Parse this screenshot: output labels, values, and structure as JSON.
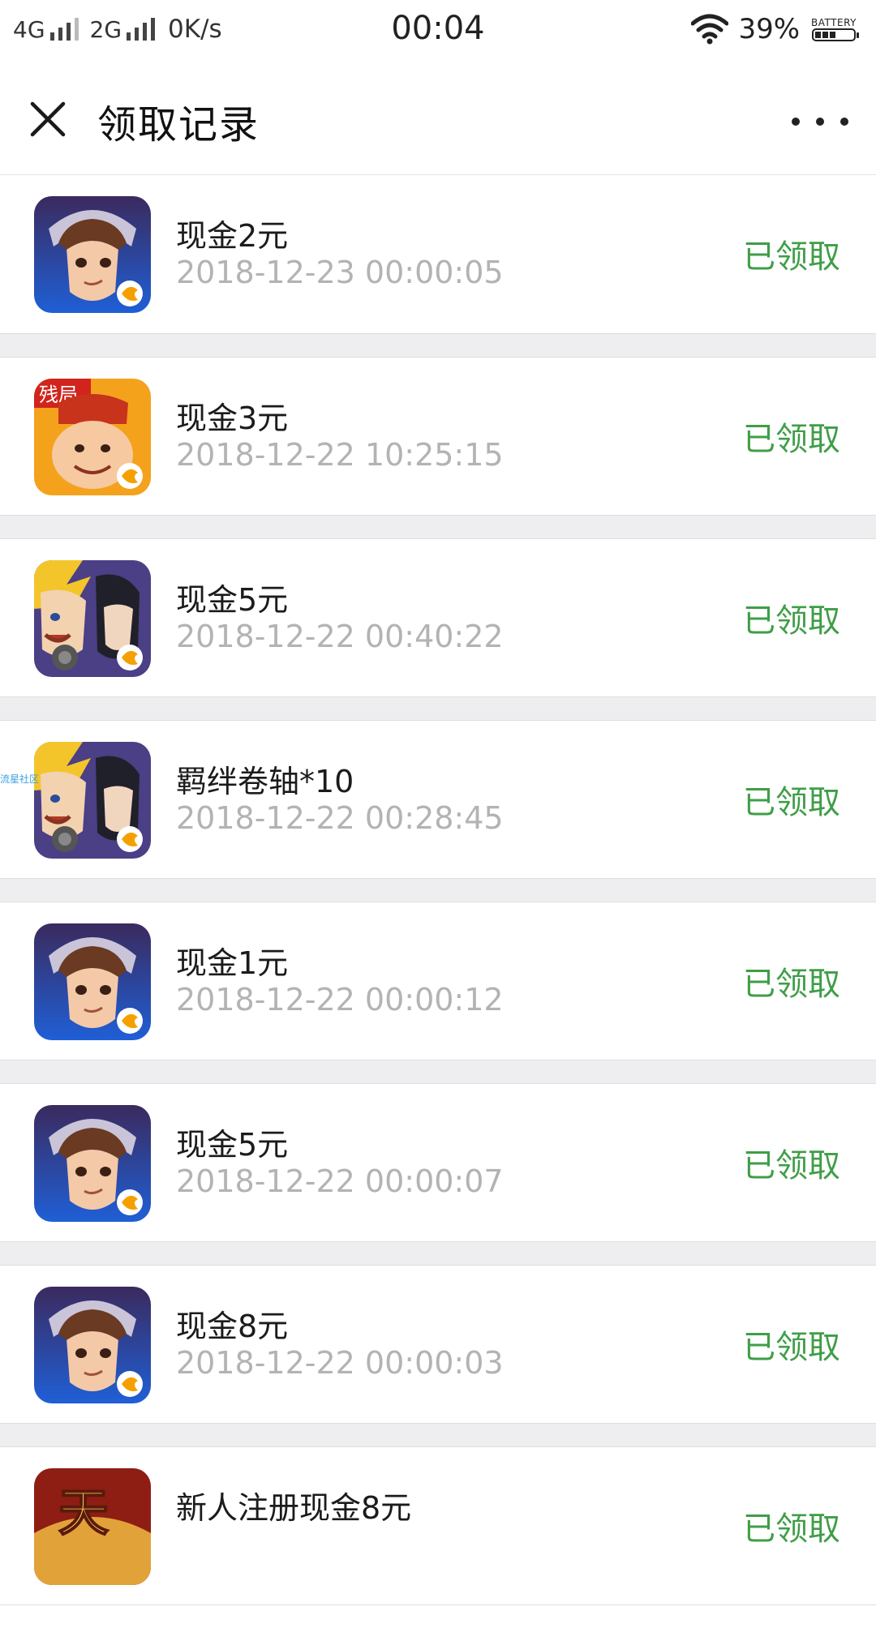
{
  "status_bar": {
    "net1": "4G",
    "net2": "2G",
    "speed": "0K/s",
    "time": "00:04",
    "battery_pct": "39%",
    "battery_label": "BATTERY"
  },
  "header": {
    "title": "领取记录"
  },
  "watermark": "流星社区",
  "records": [
    {
      "title": "现金2元",
      "time": "2018-12-23 00:00:05",
      "status": "已领取",
      "icon": "hero-game-icon"
    },
    {
      "title": "现金3元",
      "time": "2018-12-22 10:25:15",
      "status": "已领取",
      "icon": "card-game-icon",
      "badge": "残局"
    },
    {
      "title": "现金5元",
      "time": "2018-12-22 00:40:22",
      "status": "已领取",
      "icon": "ninja-game-icon"
    },
    {
      "title": "羁绊卷轴*10",
      "time": "2018-12-22 00:28:45",
      "status": "已领取",
      "icon": "ninja-game-icon"
    },
    {
      "title": "现金1元",
      "time": "2018-12-22 00:00:12",
      "status": "已领取",
      "icon": "hero-game-icon"
    },
    {
      "title": "现金5元",
      "time": "2018-12-22 00:00:07",
      "status": "已领取",
      "icon": "hero-game-icon"
    },
    {
      "title": "现金8元",
      "time": "2018-12-22 00:00:03",
      "status": "已领取",
      "icon": "hero-game-icon"
    },
    {
      "title": "新人注册现金8元",
      "time": "",
      "status": "已领取",
      "icon": "warrior-game-icon",
      "badge": "天"
    }
  ],
  "colors": {
    "status_green": "#3f9e47",
    "time_gray": "#b3b3b3",
    "separator": "#eeeef0"
  }
}
